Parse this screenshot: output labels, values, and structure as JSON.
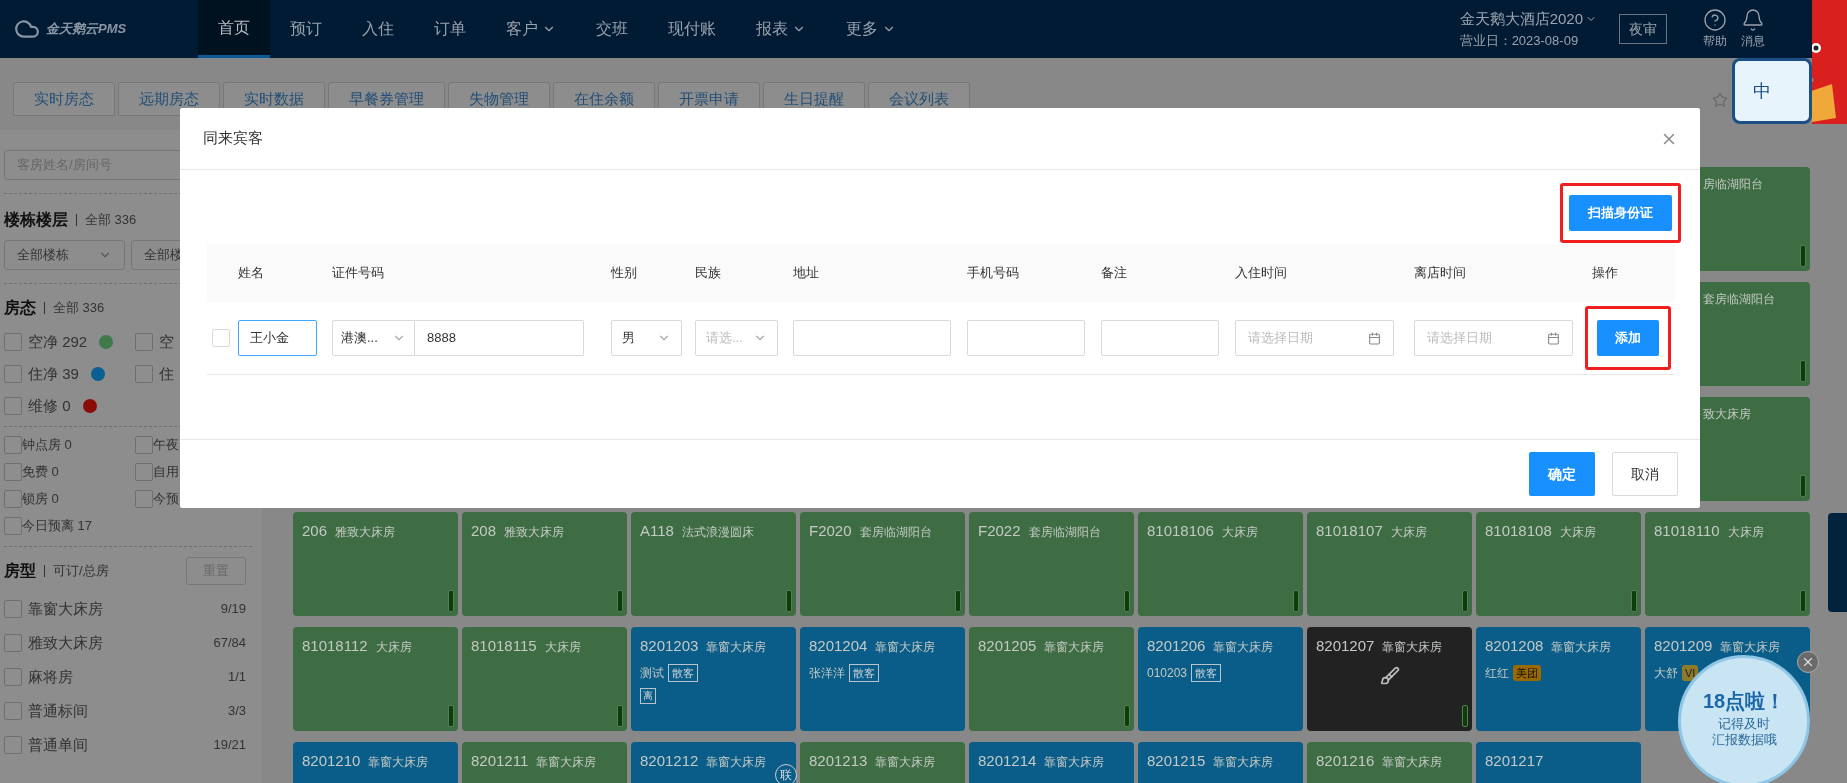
{
  "top_bar": {
    "logo": "金天鹅云PMS",
    "nav": [
      {
        "label": "首页",
        "selected": true,
        "has_menu": false
      },
      {
        "label": "预订",
        "selected": false,
        "has_menu": false
      },
      {
        "label": "入住",
        "selected": false,
        "has_menu": false
      },
      {
        "label": "订单",
        "selected": false,
        "has_menu": false
      },
      {
        "label": "客户",
        "selected": false,
        "has_menu": true
      },
      {
        "label": "交班",
        "selected": false,
        "has_menu": false
      },
      {
        "label": "现付账",
        "selected": false,
        "has_menu": false
      },
      {
        "label": "报表",
        "selected": false,
        "has_menu": true
      },
      {
        "label": "更多",
        "selected": false,
        "has_menu": true
      }
    ],
    "hotel": "金天鹅大酒店2020",
    "business_day": "营业日：2023-08-09",
    "night_audit": "夜审",
    "actions": [
      {
        "kind": "help",
        "label": "帮助"
      },
      {
        "kind": "bell",
        "label": "消息"
      }
    ]
  },
  "ime_widget": {
    "label": "中"
  },
  "tabs": [
    "实时房态",
    "远期房态",
    "实时数据",
    "早餐券管理",
    "失物管理",
    "在住余额",
    "开票申请",
    "生日提醒",
    "会议列表"
  ],
  "sidebar": {
    "search": {
      "placeholder": "客房姓名/房间号"
    },
    "building": {
      "title": "楼栋楼层",
      "count": "全部 336",
      "selects": [
        "全部楼栋",
        "全部楼"
      ]
    },
    "status": {
      "title": "房态",
      "count": "全部 336",
      "items": [
        {
          "label": "空净 292",
          "checked": false,
          "color": "#3f7a4c"
        },
        {
          "label": "空",
          "checked": false
        },
        {
          "label": "住净 39",
          "checked": false,
          "color": "#0a5f93"
        },
        {
          "label": "住",
          "checked": false
        },
        {
          "label": "维修 0",
          "checked": false,
          "color": "#8a0d08"
        }
      ]
    },
    "flags": [
      {
        "label": "钟点房 0",
        "checked": false
      },
      {
        "label": "午夜",
        "checked": false
      },
      {
        "label": "免费 0",
        "checked": false
      },
      {
        "label": "自用",
        "checked": false
      },
      {
        "label": "锁房 0",
        "checked": false
      },
      {
        "label": "今预",
        "checked": false
      },
      {
        "label": "今日预离 17",
        "checked": false
      }
    ],
    "room_types": {
      "title": "房型",
      "subtitle": "可订/总房",
      "reset": "重置",
      "items": [
        {
          "label": "靠窗大床房",
          "count": "9/19",
          "checked": false
        },
        {
          "label": "雅致大床房",
          "count": "67/84",
          "checked": false
        },
        {
          "label": "麻将房",
          "count": "1/1",
          "checked": false
        },
        {
          "label": "普通标间",
          "count": "3/3",
          "checked": false
        },
        {
          "label": "普通单间",
          "count": "19/21",
          "checked": false
        }
      ]
    }
  },
  "rooms": [
    [
      {
        "kind": "vacant",
        "room": "206",
        "type": "雅致大床房"
      },
      {
        "kind": "vacant",
        "room": "208",
        "type": "雅致大床房"
      },
      {
        "kind": "vacant",
        "room": "A118",
        "type": "法式浪漫圆床"
      },
      {
        "kind": "vacant",
        "room": "F2020",
        "type": "套房临湖阳台"
      },
      {
        "kind": "vacant",
        "room": "F2022",
        "type": "套房临湖阳台"
      },
      {
        "kind": "vacant",
        "room": "81018106",
        "type": "大床房"
      },
      {
        "kind": "vacant",
        "room": "81018107",
        "type": "大床房"
      },
      {
        "kind": "vacant",
        "room": "81018108",
        "type": "大床房"
      },
      {
        "kind": "vacant",
        "room": "81018110",
        "type": "大床房"
      }
    ],
    [
      {
        "kind": "vacant",
        "room": "81018112",
        "type": "大床房"
      },
      {
        "kind": "vacant",
        "room": "81018115",
        "type": "大床房"
      },
      {
        "kind": "occupied",
        "room": "8201203",
        "type": "靠窗大床房",
        "guest": "测试",
        "tags": [
          {
            "label": "散客",
            "kind": "outline"
          }
        ],
        "badge": "离"
      },
      {
        "kind": "occupied",
        "room": "8201204",
        "type": "靠窗大床房",
        "guest": "张洋洋",
        "tags": [
          {
            "label": "散客",
            "kind": "outline"
          }
        ]
      },
      {
        "kind": "vacant",
        "room": "8201205",
        "type": "靠窗大床房"
      },
      {
        "kind": "occupied",
        "room": "8201206",
        "type": "靠窗大床房",
        "guest": "010203",
        "tags": [
          {
            "label": "散客",
            "kind": "outline"
          }
        ]
      },
      {
        "kind": "dirty",
        "room": "8201207",
        "type": "靠窗大床房"
      },
      {
        "kind": "occupied",
        "room": "8201208",
        "type": "靠窗大床房",
        "guest": "红红",
        "tags": [
          {
            "label": "美团",
            "kind": "orange"
          }
        ]
      },
      {
        "kind": "occupied",
        "room": "8201209",
        "type": "靠窗大床房",
        "guest": "大舒",
        "tags": [
          {
            "label": "VI",
            "kind": "gold"
          }
        ]
      }
    ],
    [
      {
        "kind": "occupied",
        "room": "8201210",
        "type": "靠窗大床房"
      },
      {
        "kind": "vacant",
        "room": "8201211",
        "type": "靠窗大床房"
      },
      {
        "kind": "occupied",
        "room": "8201212",
        "type": "靠窗大床房"
      },
      {
        "kind": "vacant",
        "room": "8201213",
        "type": "靠窗大床房"
      },
      {
        "kind": "occupied",
        "room": "8201214",
        "type": "靠窗大床房"
      },
      {
        "kind": "occupied",
        "room": "8201215",
        "type": "靠窗大床房"
      },
      {
        "kind": "vacant",
        "room": "8201216",
        "type": "靠窗大床房"
      },
      {
        "kind": "occupied",
        "room": "8201217"
      }
    ]
  ],
  "rooms_behind_dialog": [
    {
      "kind": "vacant",
      "type": "房临湖阳台"
    },
    {
      "kind": "vacant",
      "type": "套房临湖阳台"
    },
    {
      "kind": "vacant",
      "type": "致大床房"
    }
  ],
  "link_badge": "联",
  "reminder": {
    "title": "18点啦！",
    "lines": [
      "记得及时",
      "汇报数据哦"
    ]
  },
  "modal": {
    "title": "同来宾客",
    "scan_button": "扫描身份证",
    "columns": [
      "姓名",
      "证件号码",
      "性别",
      "民族",
      "地址",
      "手机号码",
      "备注",
      "入住时间",
      "离店时间",
      "操作"
    ],
    "row": {
      "checked": false,
      "name": "王小金",
      "id_type": "港澳...",
      "id_number": "8888",
      "gender": "男",
      "ethnicity_placeholder": "请选...",
      "checkin_placeholder": "请选择日期",
      "checkout_placeholder": "请选择日期",
      "add_button": "添加"
    },
    "confirm": "确定",
    "cancel": "取消"
  }
}
